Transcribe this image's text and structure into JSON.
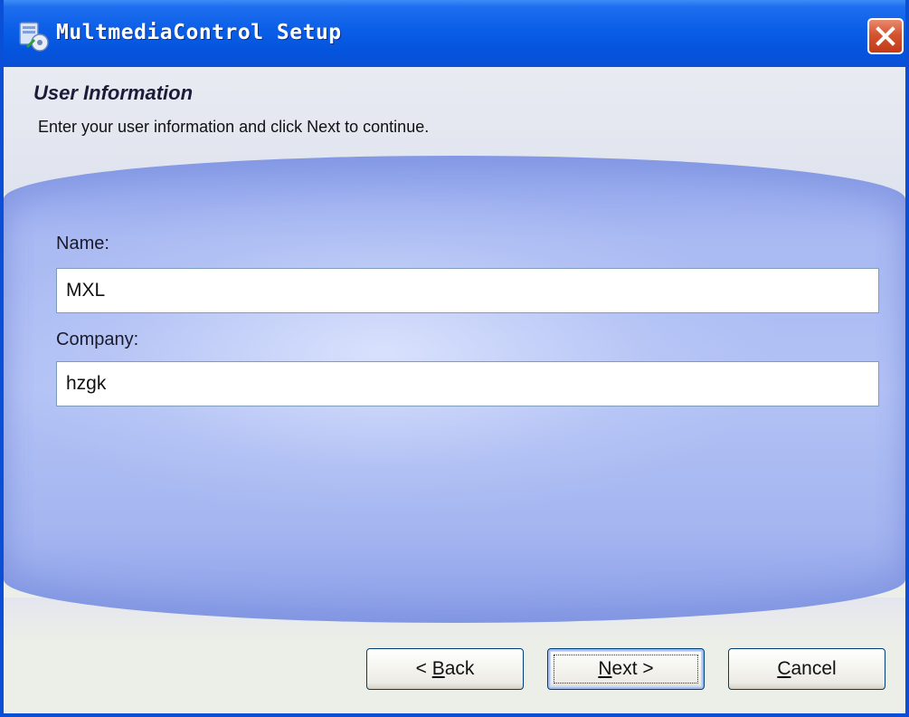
{
  "window": {
    "title": "MultmediaControl Setup",
    "close_icon": "close-icon"
  },
  "header": {
    "title": "User Information",
    "subtitle": "Enter your user information and click Next to continue."
  },
  "form": {
    "name_label": "Name:",
    "name_value": "MXL",
    "company_label": "Company:",
    "company_value": "hzgk"
  },
  "buttons": {
    "back": {
      "prefix": "< ",
      "mnemonic": "B",
      "rest": "ack"
    },
    "next": {
      "prefix": "",
      "mnemonic": "N",
      "rest": "ext >"
    },
    "cancel": {
      "prefix": "",
      "mnemonic": "C",
      "rest": "ancel"
    }
  },
  "colors": {
    "titlebar": "#0a5ee6",
    "panel": "#a9b9f2",
    "close_button": "#d4542f"
  }
}
